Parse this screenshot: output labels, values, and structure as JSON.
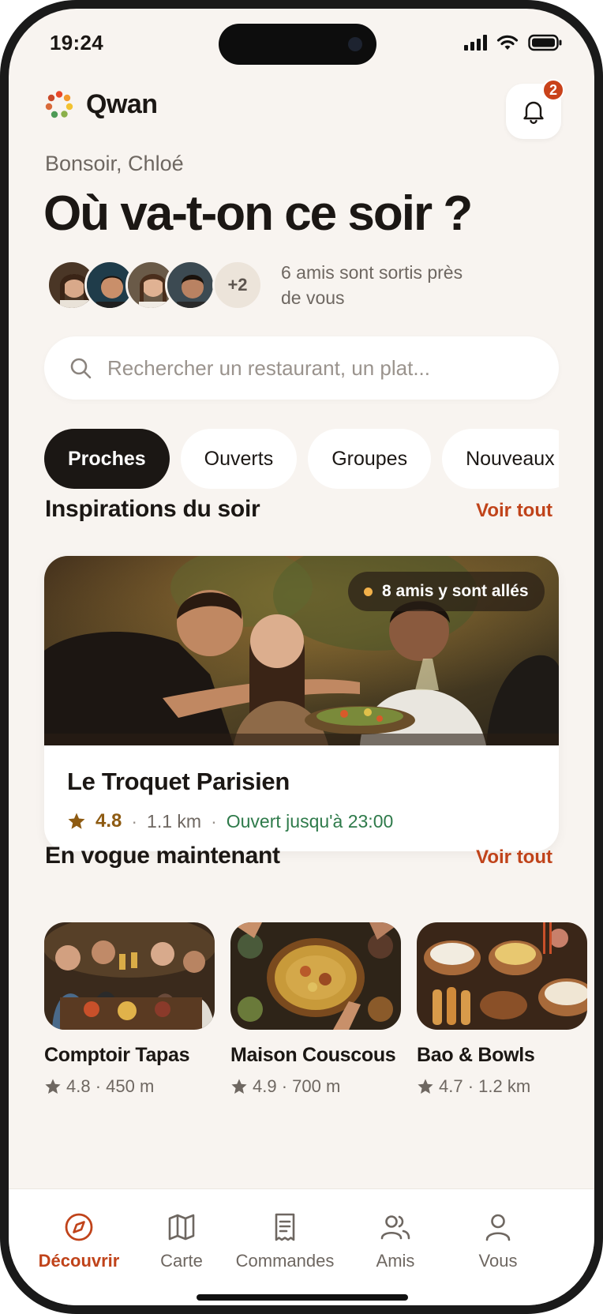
{
  "status_bar": {
    "time": "19:24"
  },
  "header": {
    "app_name": "Qwan",
    "notifications_count": "2",
    "greeting": "Bonsoir, Chloé",
    "headline": "Où va-t-on ce soir ?"
  },
  "friends": {
    "more_count": "+2",
    "text": "6 amis sont sortis près de vous"
  },
  "search": {
    "placeholder": "Rechercher un restaurant, un plat..."
  },
  "filters": [
    {
      "label": "Proches",
      "active": true
    },
    {
      "label": "Ouverts",
      "active": false
    },
    {
      "label": "Groupes",
      "active": false
    },
    {
      "label": "Nouveaux",
      "active": false
    }
  ],
  "inspirations": {
    "title": "Inspirations du soir",
    "see_all": "Voir tout",
    "card": {
      "friends_badge": "8 amis y sont allés",
      "name": "Le Troquet Parisien",
      "rating": "4.8",
      "distance": "1.1 km",
      "hours": "Ouvert jusqu'à 23:00"
    }
  },
  "trending": {
    "title": "En vogue maintenant",
    "see_all": "Voir tout",
    "items": [
      {
        "name": "Comptoir Tapas",
        "meta": "4.8 · 450 m"
      },
      {
        "name": "Maison Couscous",
        "meta": "4.9 · 700 m"
      },
      {
        "name": "Bao & Bowls",
        "meta": "4.7 · 1.2 km"
      }
    ]
  },
  "tabbar": [
    {
      "label": "Découvrir",
      "icon": "compass-icon",
      "active": true
    },
    {
      "label": "Carte",
      "icon": "map-icon",
      "active": false
    },
    {
      "label": "Commandes",
      "icon": "receipt-icon",
      "active": false
    },
    {
      "label": "Amis",
      "icon": "friends-icon",
      "active": false
    },
    {
      "label": "Vous",
      "icon": "profile-icon",
      "active": false
    }
  ],
  "colors": {
    "accent": "#c0431a",
    "open_green": "#2e7a4a",
    "rating_gold": "#8e5b12",
    "background": "#f8f4f0",
    "chip_active": "#1b1714"
  }
}
